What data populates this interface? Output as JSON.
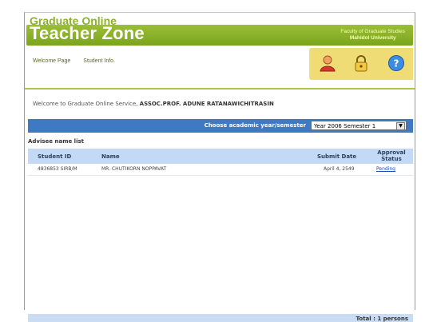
{
  "header": {
    "brand_top": "Graduate Online",
    "brand_main": "Teacher Zone",
    "faculty": "Faculty of Graduate Studies",
    "university": "Mahidol University"
  },
  "nav": {
    "items": [
      "Welcome Page",
      "Student Info."
    ]
  },
  "icons": [
    "user-icon",
    "lock-icon",
    "help-icon"
  ],
  "welcome": {
    "prefix": "Welcome to Graduate Online Service,",
    "name": "ASSOC.PROF. ADUNE RATANAWICHITRASIN"
  },
  "yearbar": {
    "label": "Choose academic year/semester",
    "selected": "Year 2006 Semester 1"
  },
  "advisee": {
    "title": "Advisee name list",
    "columns": [
      "Student ID",
      "Name",
      "Submit Date",
      "Approval Status"
    ],
    "rows": [
      {
        "id": "4836853 SIRB/M",
        "name": "MR. CHUTIKORN NOPPAVAT",
        "date": "April 4, 2549",
        "status": "Pending"
      }
    ]
  },
  "footer": {
    "total": "Total : 1 persons"
  },
  "colors": {
    "green": "#8db12a",
    "blue_bar": "#3f79c3",
    "header_row": "#c3d9f5",
    "tray": "#f0dc74"
  }
}
